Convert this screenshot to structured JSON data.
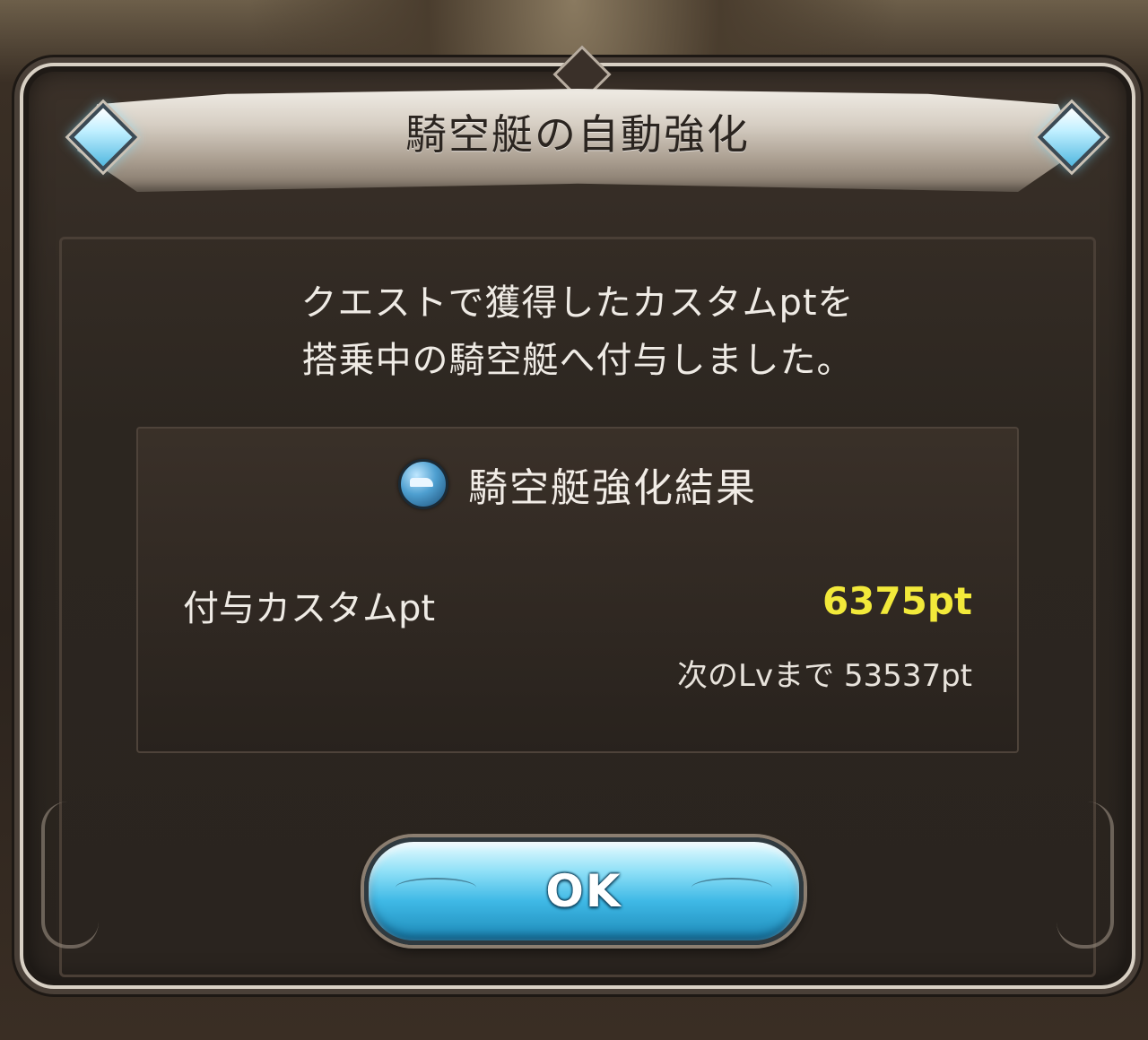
{
  "dialog": {
    "title": "騎空艇の自動強化",
    "message_line1": "クエストで獲得したカスタムptを",
    "message_line2": "搭乗中の騎空艇へ付与しました。",
    "result": {
      "title": "騎空艇強化結果",
      "icon": "airship-icon",
      "granted_label": "付与カスタムpt",
      "granted_value": "6375pt",
      "next_level_text": "次のLvまで 53537pt"
    },
    "ok_label": "OK"
  },
  "colors": {
    "accent_value": "#f2e93a",
    "button": "#3fb9e6",
    "gem": "#bfefff"
  }
}
